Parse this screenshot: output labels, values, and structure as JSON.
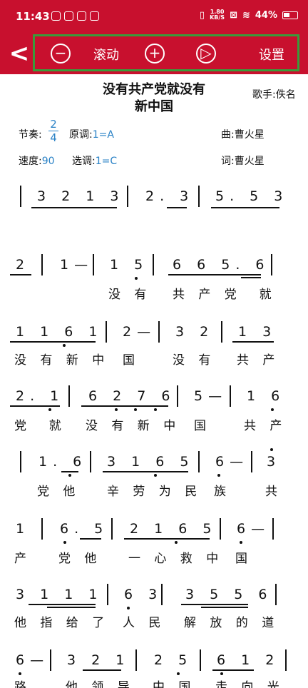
{
  "status": {
    "time": "11:43",
    "net_speed_top": "1.80",
    "net_speed_bottom": "KB/S",
    "battery": "44%"
  },
  "toolbar": {
    "back": "<",
    "zoom_out": "−",
    "scroll_label": "滚动",
    "zoom_in": "+",
    "play": "▷",
    "settings_label": "设置"
  },
  "song": {
    "title_line1": "没有共产党就没有",
    "title_line2": "新中国",
    "singer": "歌手:佚名",
    "meter_label": "节奏:",
    "meter_top": "2",
    "meter_bottom": "4",
    "orig_key_label": "原调:",
    "orig_key": "1=A",
    "composer": "曲:曹火星",
    "tempo_label": "速度:",
    "tempo": "90",
    "sel_key_label": "选调:",
    "sel_key": "1=C",
    "lyricist": "词:曹火星"
  },
  "rows": [
    {
      "notes": "3 2 1 3",
      "notes2": "2. 3",
      "notes3": "5. 5 3",
      "lyrics": ""
    },
    {
      "notes": "2",
      "notes2": "1—",
      "notes3": "1 5",
      "notes4": "6 6 5. 6",
      "lyrics": "没 有",
      "lyrics2": "共 产 党  就"
    },
    {
      "notes": "1 1 6 1",
      "notes2": "2—",
      "notes3": "3 2",
      "notes4": "1 3",
      "lyrics": "没 有 新 中",
      "lyrics2": "国",
      "lyrics3": "没 有",
      "lyrics4": "共 产"
    },
    {
      "notes": "2. 1",
      "notes2": "6 2 7 6",
      "notes3": "5—",
      "notes4": "1 6",
      "lyrics": "党  就",
      "lyrics2": "没 有 新 中",
      "lyrics3": "国",
      "lyrics4": "共 产"
    },
    {
      "notes": "1. 6",
      "notes2": "3 1 6 5",
      "notes3": "6—",
      "notes4": "3",
      "lyrics": "党 他",
      "lyrics2": "辛 劳 为 民",
      "lyrics3": "族",
      "lyrics4": "共"
    },
    {
      "notes": "1",
      "notes2": "6. 5",
      "notes3": "2 1 6 5",
      "notes4": "6—",
      "lyrics": "产",
      "lyrics2": "党 他",
      "lyrics3": "一 心 救 中",
      "lyrics4": "国"
    },
    {
      "notes": "3 1 1 1",
      "notes2": "6 3",
      "notes3": "3 5 5 6",
      "lyrics": "他 指 给 了",
      "lyrics2": "人 民",
      "lyrics3": "解 放 的 道"
    },
    {
      "notes": "6—",
      "notes2": "3 2 1",
      "notes3": "2 5",
      "notes4": "6 1 2",
      "lyrics": "路",
      "lyrics2": "他 领 导",
      "lyrics3": "中 国",
      "lyrics4": "走 向 光"
    }
  ]
}
